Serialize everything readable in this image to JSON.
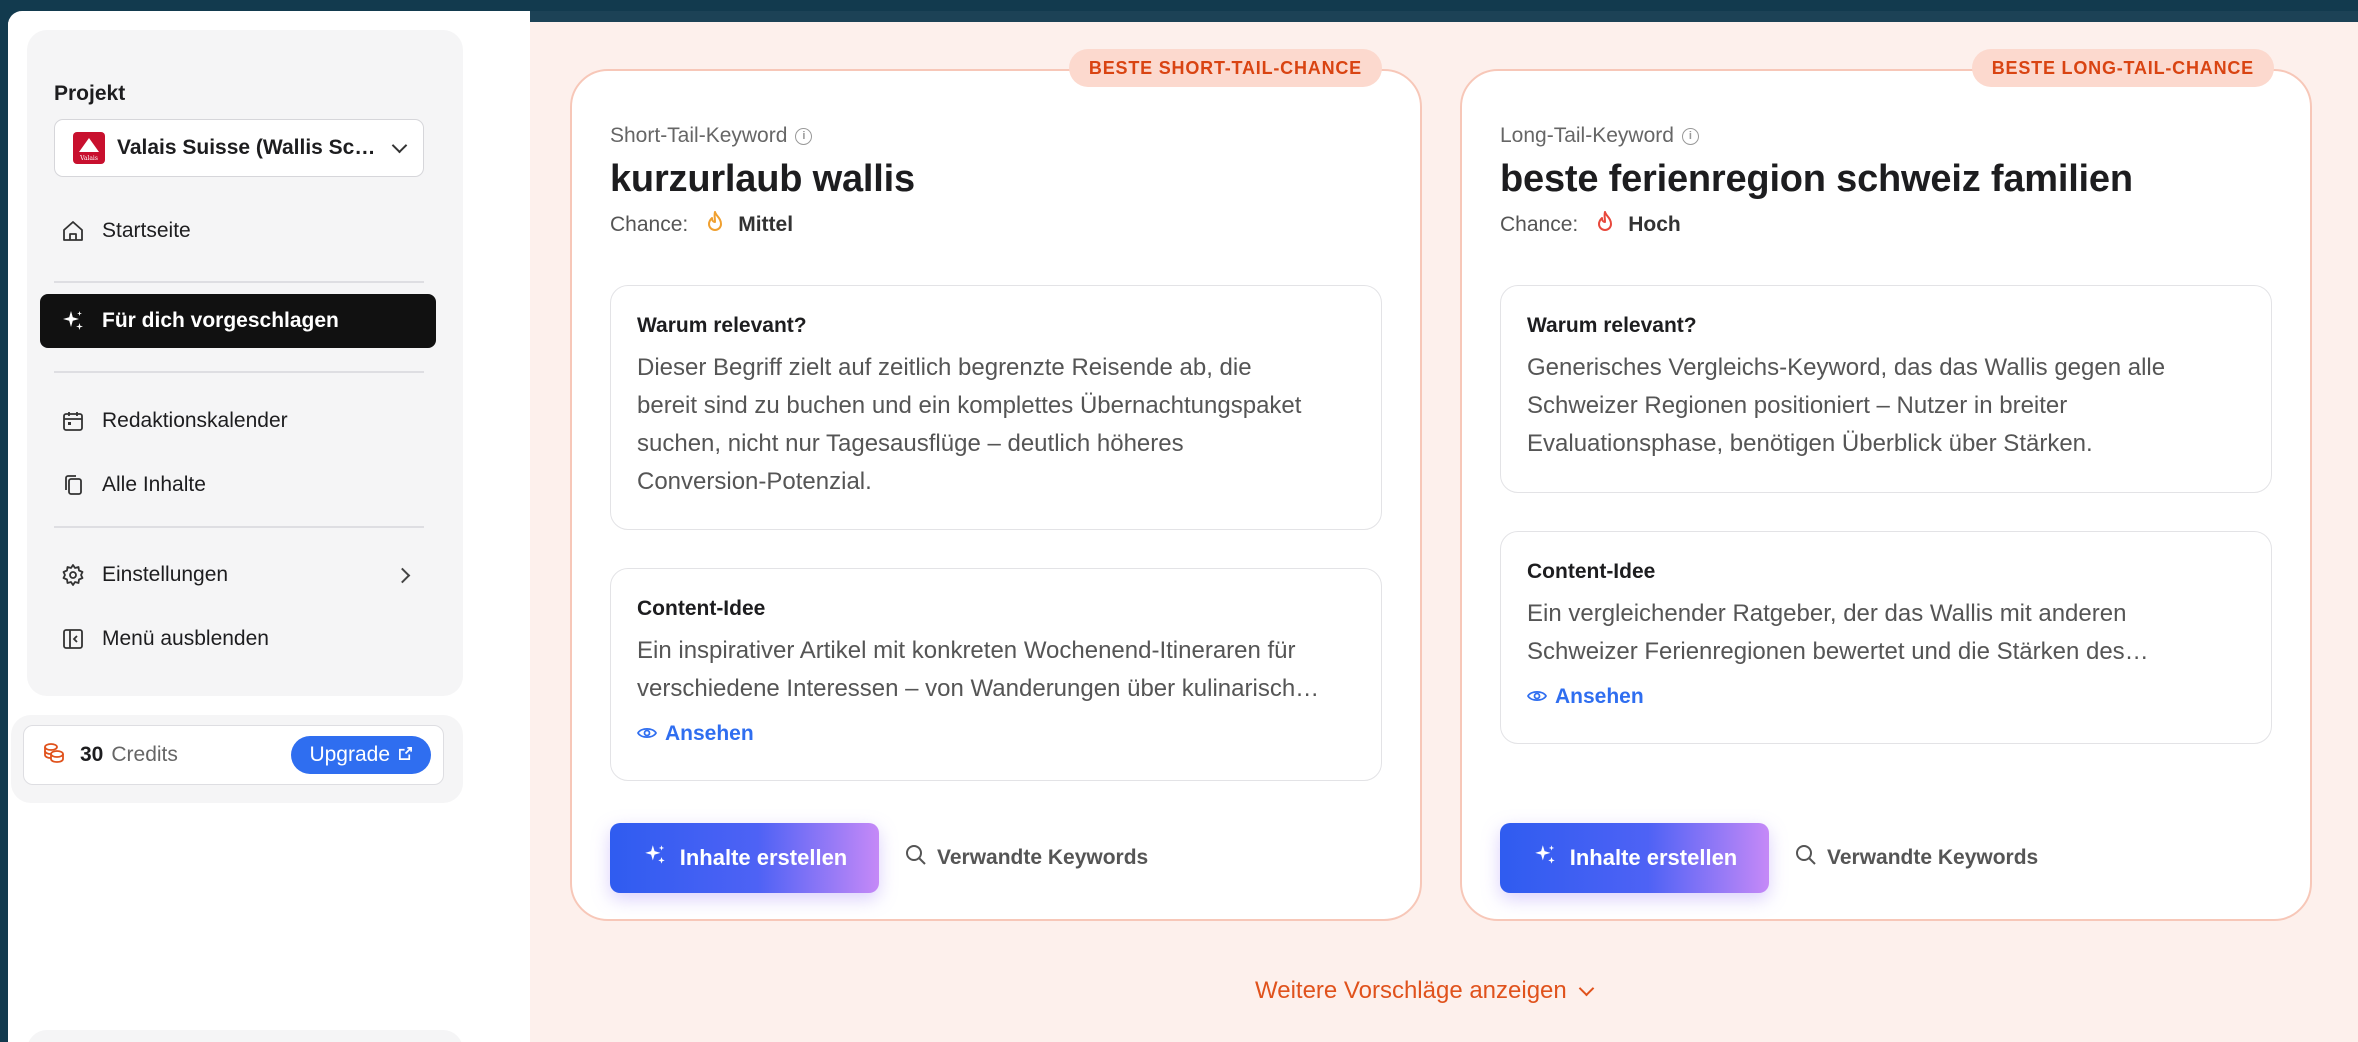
{
  "sidebar": {
    "project_label": "Projekt",
    "project_name": "Valais Suisse (Wallis Sc…",
    "project_logo_text": "Valais",
    "nav": {
      "startseite": "Startseite",
      "vorgeschlagen": "Für dich vorgeschlagen",
      "redaktionskalender": "Redaktionskalender",
      "alle_inhalte": "Alle Inhalte",
      "einstellungen": "Einstellungen",
      "menu_ausblenden": "Menü ausblenden"
    },
    "active_item": "Für dich vorgeschlagen",
    "credits": {
      "count": "30",
      "label": "Credits",
      "upgrade_label": "Upgrade"
    }
  },
  "cards": [
    {
      "badge": "BESTE SHORT-TAIL-CHANCE",
      "type_label": "Short-Tail-Keyword",
      "keyword": "kurzurlaub wallis",
      "chance_label": "Chance:",
      "chance_value": "Mittel",
      "chance_color": "#f0a030",
      "relevance_title": "Warum relevant?",
      "relevance_lines": [
        "Dieser Begriff zielt auf zeitlich begrenzte Reisende ab, die",
        "bereit sind zu buchen und ein komplettes Übernachtungspaket",
        "suchen, nicht nur Tagesausflüge – deutlich höheres",
        "Conversion-Potenzial."
      ],
      "idea_title": "Content-Idee",
      "idea_lines": [
        "Ein inspirativer Artikel mit konkreten Wochenend-Itineraren für",
        "verschiedene Interessen – von Wanderungen über kulinarisch…"
      ],
      "view_label": "Ansehen",
      "create_label": "Inhalte erstellen",
      "related_label": "Verwandte Keywords"
    },
    {
      "badge": "BESTE LONG-TAIL-CHANCE",
      "type_label": "Long-Tail-Keyword",
      "keyword": "beste ferienregion schweiz familien",
      "chance_label": "Chance:",
      "chance_value": "Hoch",
      "chance_color": "#e8483c",
      "relevance_title": "Warum relevant?",
      "relevance_lines": [
        "Generisches Vergleichs-Keyword, das das Wallis gegen alle",
        "Schweizer Regionen positioniert – Nutzer in breiter",
        "Evaluationsphase, benötigen Überblick über Stärken."
      ],
      "idea_title": "Content-Idee",
      "idea_lines": [
        "Ein vergleichender Ratgeber, der das Wallis mit anderen",
        "Schweizer Ferienregionen bewertet und die Stärken des…"
      ],
      "view_label": "Ansehen",
      "create_label": "Inhalte erstellen",
      "related_label": "Verwandte Keywords"
    }
  ],
  "more_label": "Weitere Vorschläge anzeigen",
  "colors": {
    "accent_blue": "#2f6ef0",
    "accent_orange": "#e0521c",
    "card_border": "#f7c7b8",
    "main_bg": "#fdf0ec"
  }
}
